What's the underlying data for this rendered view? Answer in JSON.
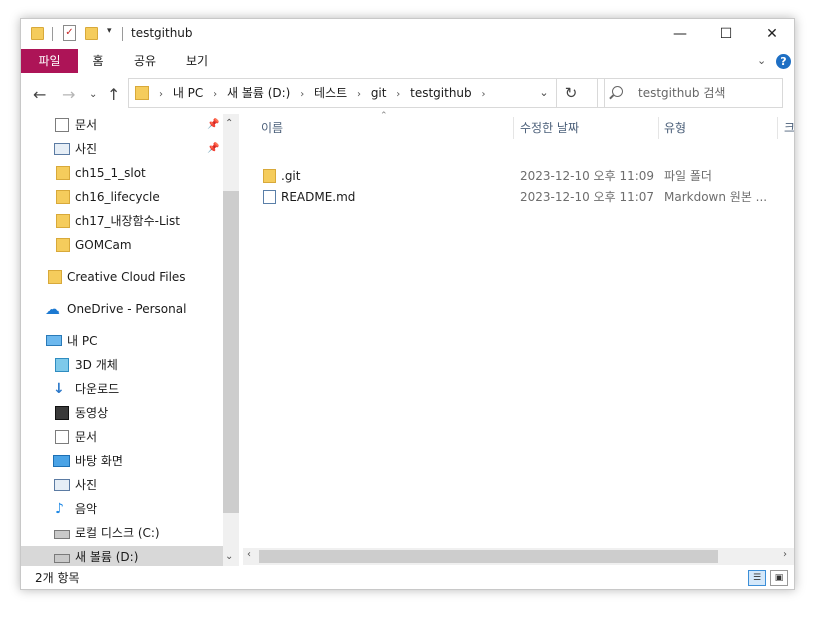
{
  "window": {
    "title": "testgithub"
  },
  "ribbon": {
    "tabs": [
      "파일",
      "홈",
      "공유",
      "보기"
    ]
  },
  "address": {
    "crumbs": [
      "내 PC",
      "새 볼륨 (D:)",
      "테스트",
      "git",
      "testgithub"
    ]
  },
  "search": {
    "placeholder": "testgithub 검색"
  },
  "nav": {
    "items": [
      {
        "label": "문서",
        "pinned": true,
        "icon": "document-icon"
      },
      {
        "label": "사진",
        "pinned": true,
        "icon": "pictures-icon"
      },
      {
        "label": "ch15_1_slot",
        "icon": "folder-icon"
      },
      {
        "label": "ch16_lifecycle",
        "icon": "folder-icon"
      },
      {
        "label": "ch17_내장함수-List",
        "icon": "folder-icon"
      },
      {
        "label": "GOMCam",
        "icon": "folder-icon"
      },
      {
        "label": "Creative Cloud Files",
        "icon": "creative-cloud-icon"
      },
      {
        "label": "OneDrive - Personal",
        "icon": "onedrive-icon"
      },
      {
        "label": "내 PC",
        "icon": "pc-icon"
      },
      {
        "label": "3D 개체",
        "icon": "3d-objects-icon"
      },
      {
        "label": "다운로드",
        "icon": "download-icon"
      },
      {
        "label": "동영상",
        "icon": "video-icon"
      },
      {
        "label": "문서",
        "icon": "document-icon"
      },
      {
        "label": "바탕 화면",
        "icon": "desktop-icon"
      },
      {
        "label": "사진",
        "icon": "pictures-icon"
      },
      {
        "label": "음악",
        "icon": "music-icon"
      },
      {
        "label": "로컬 디스크 (C:)",
        "icon": "drive-icon"
      },
      {
        "label": "새 볼륨 (D:)",
        "icon": "drive-icon",
        "selected": true
      }
    ]
  },
  "columns": {
    "name": "이름",
    "modified": "수정한 날짜",
    "type": "유형",
    "size": "크"
  },
  "files": [
    {
      "name": ".git",
      "modified": "2023-12-10 오후 11:09",
      "type": "파일 폴더",
      "icon": "folder-icon"
    },
    {
      "name": "README.md",
      "modified": "2023-12-10 오후 11:07",
      "type": "Markdown 원본 ...",
      "icon": "markdown-file-icon"
    }
  ],
  "status": {
    "count": "2개 항목"
  }
}
